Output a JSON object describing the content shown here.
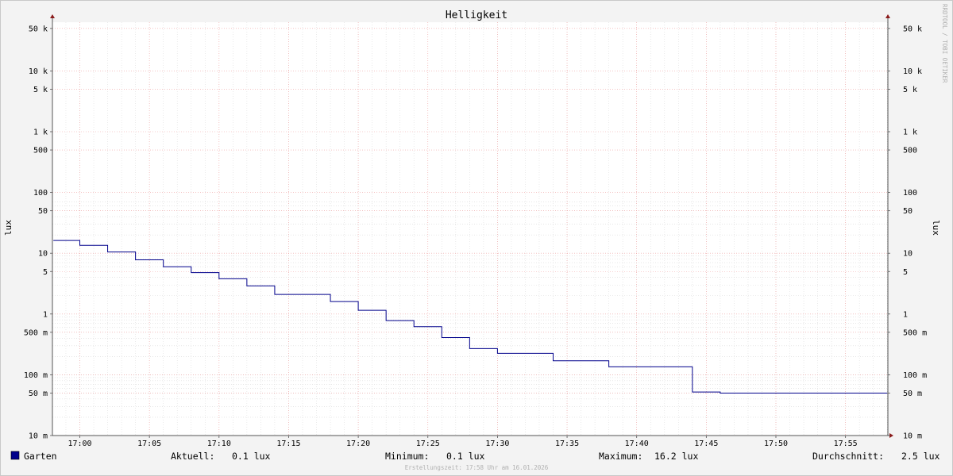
{
  "chart_data": {
    "type": "line",
    "title": "Helligkeit",
    "ylabel": "lux",
    "ylabel_right": "lux",
    "y_scale": "log",
    "ylim": [
      10,
      70000
    ],
    "y_ticks": [
      {
        "value": 10,
        "label": "10 m"
      },
      {
        "value": 50,
        "label": "50 m"
      },
      {
        "value": 100,
        "label": "100 m"
      },
      {
        "value": 500,
        "label": "500 m"
      },
      {
        "value": 1000,
        "label": "1"
      },
      {
        "value": 5000,
        "label": "5"
      },
      {
        "value": 10000,
        "label": "10"
      },
      {
        "value": 50000,
        "label": "50"
      },
      {
        "value": 100000,
        "label": "100"
      },
      {
        "value": 500000,
        "label": "500"
      },
      {
        "value": 1000000,
        "label": "1 k"
      },
      {
        "value": 5000000,
        "label": "5 k"
      },
      {
        "value": 10000000,
        "label": "10 k"
      },
      {
        "value": 50000000,
        "label": "50 k"
      }
    ],
    "x_unit": "minutes",
    "xlim": [
      -1.9,
      58
    ],
    "x_ticks": [
      {
        "value": 0,
        "label": "17:00"
      },
      {
        "value": 5,
        "label": "17:05"
      },
      {
        "value": 10,
        "label": "17:10"
      },
      {
        "value": 15,
        "label": "17:15"
      },
      {
        "value": 20,
        "label": "17:20"
      },
      {
        "value": 25,
        "label": "17:25"
      },
      {
        "value": 30,
        "label": "17:30"
      },
      {
        "value": 35,
        "label": "17:35"
      },
      {
        "value": 40,
        "label": "17:40"
      },
      {
        "value": 45,
        "label": "17:45"
      },
      {
        "value": 50,
        "label": "17:50"
      },
      {
        "value": 55,
        "label": "17:55"
      }
    ],
    "grid": true,
    "series": [
      {
        "name": "Garten",
        "color": "#00008b",
        "steps": [
          {
            "start": -1.9,
            "value": 16200
          },
          {
            "start": 0,
            "value": 13500
          },
          {
            "start": 2,
            "value": 10500
          },
          {
            "start": 4,
            "value": 7800
          },
          {
            "start": 6,
            "value": 6000
          },
          {
            "start": 8,
            "value": 4800
          },
          {
            "start": 10,
            "value": 3800
          },
          {
            "start": 12,
            "value": 2900
          },
          {
            "start": 14,
            "value": 2100
          },
          {
            "start": 18,
            "value": 1600
          },
          {
            "start": 20,
            "value": 1150
          },
          {
            "start": 22,
            "value": 780
          },
          {
            "start": 24,
            "value": 620
          },
          {
            "start": 26,
            "value": 410
          },
          {
            "start": 28,
            "value": 270
          },
          {
            "start": 30,
            "value": 225
          },
          {
            "start": 34,
            "value": 170
          },
          {
            "start": 38,
            "value": 135
          },
          {
            "start": 44,
            "value": 52
          },
          {
            "start": 46,
            "value": 50
          }
        ],
        "end": 58
      }
    ]
  },
  "legend": {
    "series_name": "Garten",
    "swatch_color": "#00008b",
    "current_label": "Aktuell:",
    "current_value": "0.1 lux",
    "min_label": "Minimum:",
    "min_value": "0.1 lux",
    "max_label": "Maximum:",
    "max_value": "16.2 lux",
    "avg_label": "Durchschnitt:",
    "avg_value": "2.5 lux"
  },
  "footer": {
    "created": "Erstellungszeit: 17:58 Uhr am 16.01.2026"
  },
  "watermark": "RRDTOOL / TOBI OETIKER"
}
